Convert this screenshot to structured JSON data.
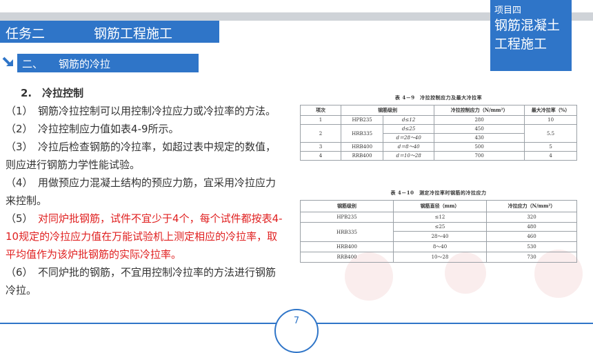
{
  "project": {
    "small": "项目四",
    "line1": "钢筋混凝土",
    "line2": "工程施工"
  },
  "task": {
    "label": "任务二",
    "title": "钢筋工程施工"
  },
  "section": {
    "num": "二、",
    "title": "钢筋的冷拉"
  },
  "heading": "2.　冷拉控制",
  "paragraphs": [
    "（1）　钢筋冷拉控制可以用控制冷拉应力或冷拉率的方法。",
    "（2）　冷拉控制应力值如表4-9所示。",
    "（3）　冷拉后检查钢筋的冷拉率，如超过表中规定的数值，则应进行钢筋力学性能试验。",
    "（4）　用做预应力混凝土结构的预应力筋，宜采用冷拉应力来控制。"
  ],
  "p5_num": "（5）　",
  "p5_red": "对同炉批钢筋，试件不宜少于4个，每个试件都按表4-10规定的冷拉应力值在万能试验机上测定相应的冷拉率，取平均值作为该炉批钢筋的实际冷拉率。",
  "p6": "（6）　不同炉批的钢筋，不宜用控制冷拉率的方法进行钢筋冷拉。",
  "table1": {
    "caption": "表 4－9　冷拉控制应力及最大冷拉率",
    "headers": [
      "项次",
      "钢筋级别",
      "冷拉控制应力（N/mm²）",
      "最大冷拉率（%）"
    ],
    "rows": [
      [
        "1",
        "HPB235",
        "d≤12",
        "280",
        "10"
      ],
      [
        "2",
        "HRB335",
        "d≤25",
        "450",
        "5.5"
      ],
      [
        "",
        "",
        "d＝28～40",
        "430",
        ""
      ],
      [
        "3",
        "HRB400",
        "d＝8～40",
        "500",
        "5"
      ],
      [
        "4",
        "RRB400",
        "d＝10～28",
        "700",
        "4"
      ]
    ]
  },
  "table2": {
    "caption": "表 4－10　测定冷拉率时钢筋的冷拉应力",
    "headers": [
      "钢筋级别",
      "钢筋直径（mm）",
      "冷拉应力（N/mm²）"
    ],
    "rows": [
      [
        "HPB235",
        "≤12",
        "320"
      ],
      [
        "HRB335",
        "≤25",
        "480"
      ],
      [
        "",
        "28～40",
        "460"
      ],
      [
        "HRB400",
        "8～40",
        "530"
      ],
      [
        "RRB400",
        "10～28",
        "730"
      ]
    ]
  },
  "page_number": "7",
  "colors": {
    "accent": "#2f75c8",
    "highlight": "#e02020"
  }
}
